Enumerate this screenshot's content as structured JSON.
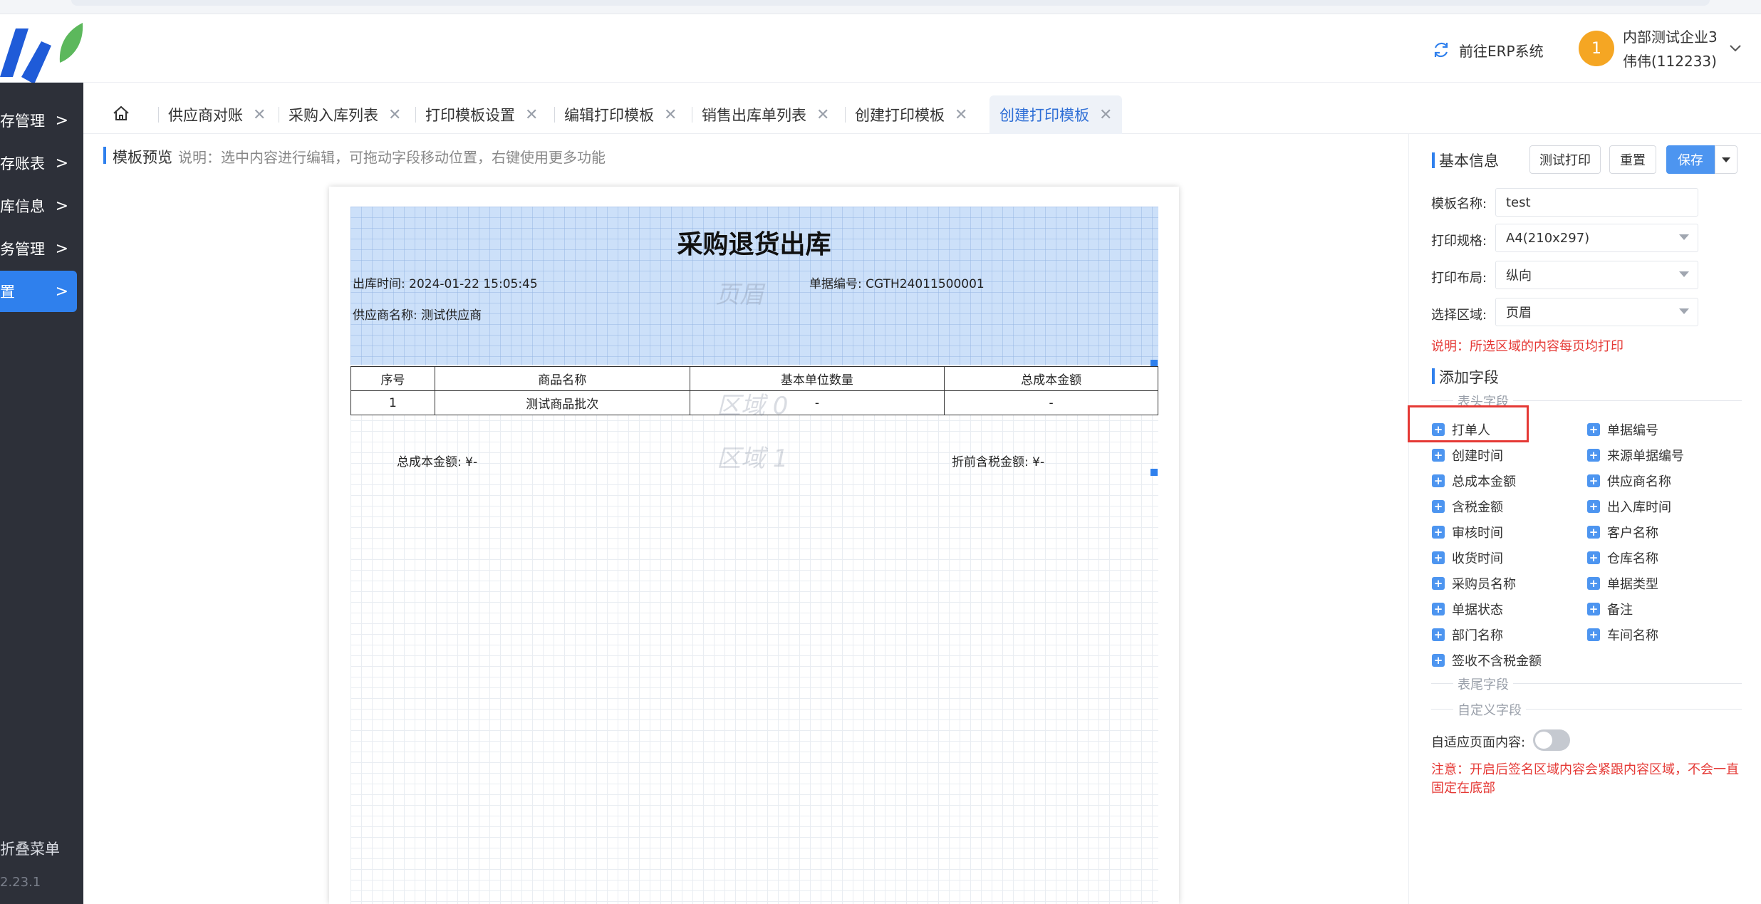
{
  "header": {
    "erp_link": "前往ERP系统",
    "user_badge": "1",
    "user_company": "内部测试企业3",
    "user_name": "伟伟(112233)"
  },
  "sidebar": {
    "items": [
      {
        "label": "存管理"
      },
      {
        "label": "存账表"
      },
      {
        "label": "库信息"
      },
      {
        "label": "务管理"
      },
      {
        "label": "置"
      }
    ],
    "collapse": "折叠菜单",
    "version": "2.23.1"
  },
  "tabs": [
    {
      "label": "供应商对账"
    },
    {
      "label": "采购入库列表"
    },
    {
      "label": "打印模板设置"
    },
    {
      "label": "编辑打印模板"
    },
    {
      "label": "销售出库单列表"
    },
    {
      "label": "创建打印模板"
    },
    {
      "label": "创建打印模板"
    }
  ],
  "preview": {
    "title": "模板预览",
    "desc": "说明：选中内容进行编辑，可拖动字段移动位置，右键使用更多功能"
  },
  "doc": {
    "title": "采购退货出库",
    "out_time": "出库时间:   2024-01-22 15:05:45",
    "doc_no": "单据编号:  CGTH24011500001",
    "supplier": "供应商名称:  测试供应商",
    "wm_header": "页眉",
    "wm_region0": "区域 0",
    "wm_region1": "区域 1",
    "table_headers": [
      "序号",
      "商品名称",
      "基本单位数量",
      "总成本金额"
    ],
    "table_rows": [
      [
        "1",
        "测试商品批次",
        "-",
        "-"
      ]
    ],
    "total_cost": "总成本金额:  ¥-",
    "discount_tax": "折前含税金额:  ¥-"
  },
  "panel": {
    "basic_title": "基本信息",
    "btn_test": "测试打印",
    "btn_reset": "重置",
    "btn_save": "保存",
    "name_label": "模板名称:",
    "name_value": "test",
    "spec_label": "打印规格:",
    "spec_value": "A4(210x297)",
    "layout_label": "打印布局:",
    "layout_value": "纵向",
    "area_label": "选择区域:",
    "area_value": "页眉",
    "area_note": "说明：所选区域的内容每页均打印",
    "add_title": "添加字段",
    "group_head": "表头字段",
    "group_tail": "表尾字段",
    "group_custom": "自定义字段",
    "fields_left": [
      "打单人",
      "创建时间",
      "总成本金额",
      "含税金额",
      "审核时间",
      "收货时间",
      "采购员名称",
      "单据状态",
      "部门名称",
      "签收不含税金额"
    ],
    "fields_right": [
      "单据编号",
      "来源单据编号",
      "供应商名称",
      "出入库时间",
      "客户名称",
      "仓库名称",
      "单据类型",
      "备注",
      "车间名称"
    ],
    "adaptive_label": "自适应页面内容:",
    "adaptive_note_1": "注意：开启后签名区域内容会紧跟内容区域，不会一直",
    "adaptive_note_2": "固定在底部"
  },
  "colors": {
    "sidebar_bg": "#2d3039",
    "accent": "#2f80ed",
    "highlight": "#e53935",
    "avatar": "#f5a623"
  }
}
